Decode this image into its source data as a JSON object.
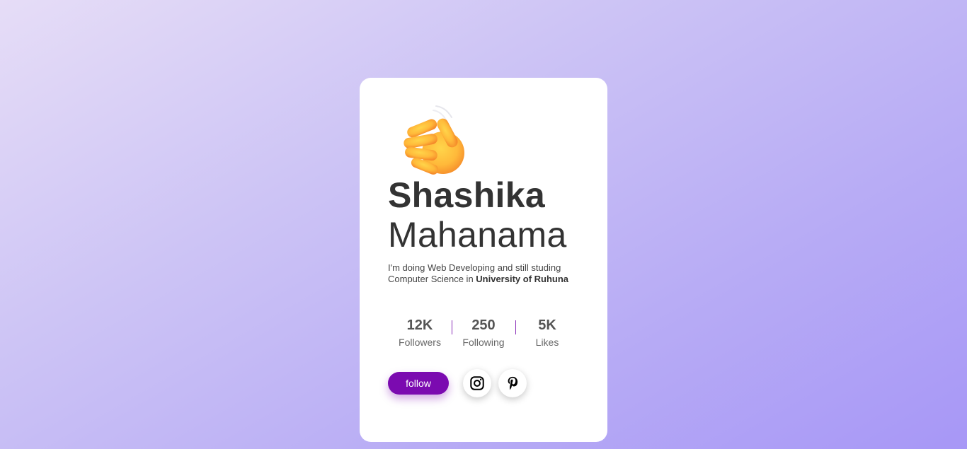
{
  "profile": {
    "emoji_icon": "waving-hand-icon",
    "first_name": "Shashika",
    "last_name": "Mahanama",
    "bio_text": "I'm doing Web Developing and still studing Computer Science in ",
    "bio_highlight": "University of Ruhuna"
  },
  "stats": [
    {
      "value": "12K",
      "label": "Followers"
    },
    {
      "value": "250",
      "label": "Following"
    },
    {
      "value": "5K",
      "label": "Likes"
    }
  ],
  "actions": {
    "follow_label": "follow",
    "social": [
      {
        "icon": "instagram-icon"
      },
      {
        "icon": "pinterest-icon"
      }
    ]
  },
  "colors": {
    "accent": "#7b0ab0",
    "card": "#ffffff",
    "text": "#333333",
    "divider": "#8a2fb8"
  }
}
